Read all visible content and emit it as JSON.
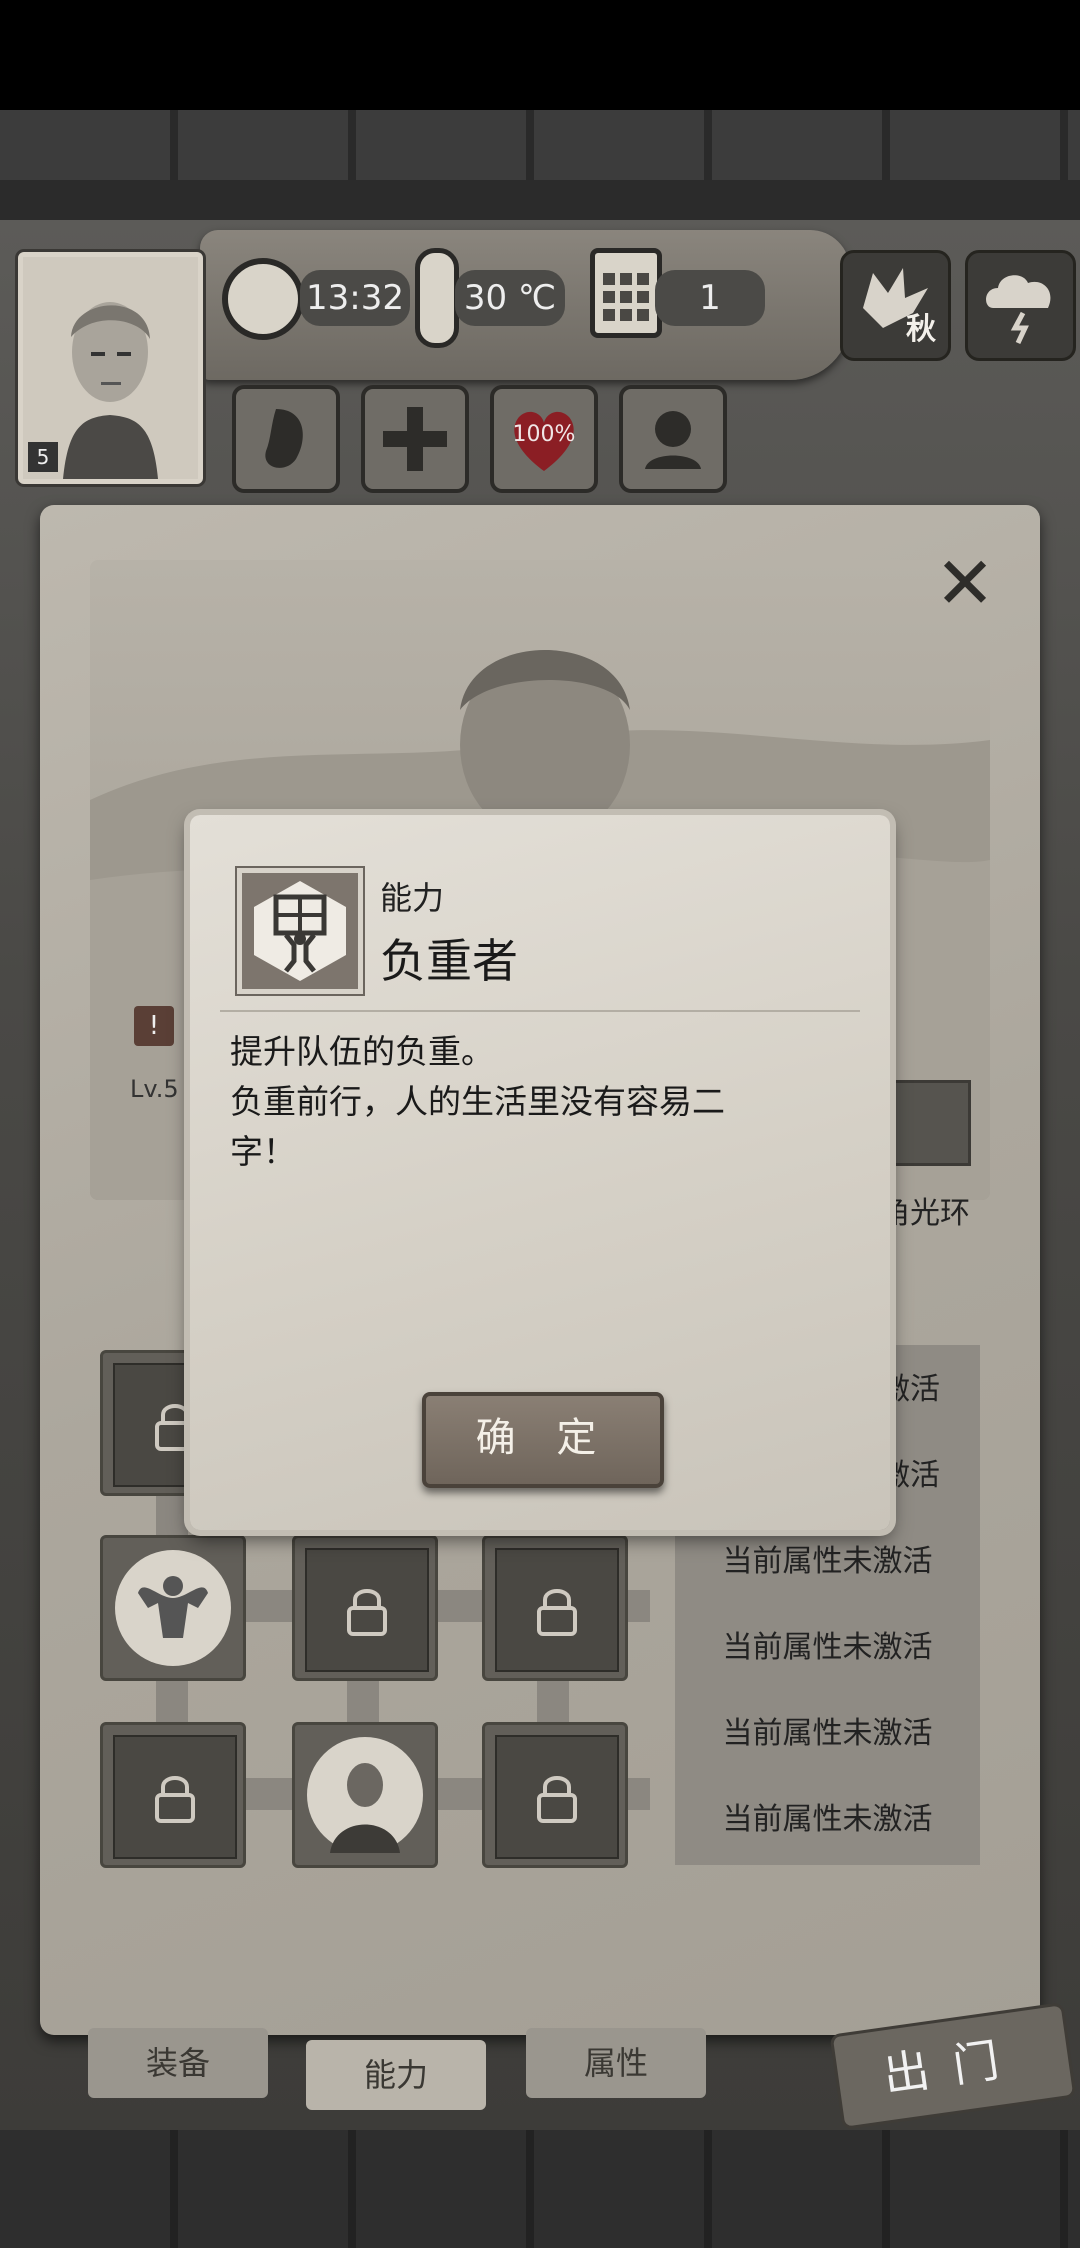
{
  "hud": {
    "time": "13:32",
    "temperature": "30 ℃",
    "day": "1",
    "season": "秋",
    "level": "5"
  },
  "stats": {
    "life_percent": "100%"
  },
  "panel": {
    "level_label": "Lv.5",
    "halo_label": "角光环",
    "attribute_rows": [
      "激活",
      "激活",
      "当前属性未激活",
      "当前属性未激活",
      "当前属性未激活",
      "当前属性未激活"
    ]
  },
  "tabs": {
    "equipment": "装备",
    "ability": "能力",
    "attributes": "属性",
    "go_out": "出门"
  },
  "modal": {
    "category": "能力",
    "title": "负重者",
    "description_lines": [
      "提升队伍的负重。",
      "负重前行，人的生活里没有容易二",
      "字！"
    ],
    "confirm_label": "确 定"
  },
  "colors": {
    "parchment": "#d5d0c6",
    "button_wood": "#6f655b",
    "life_heart": "#8b1e24"
  }
}
